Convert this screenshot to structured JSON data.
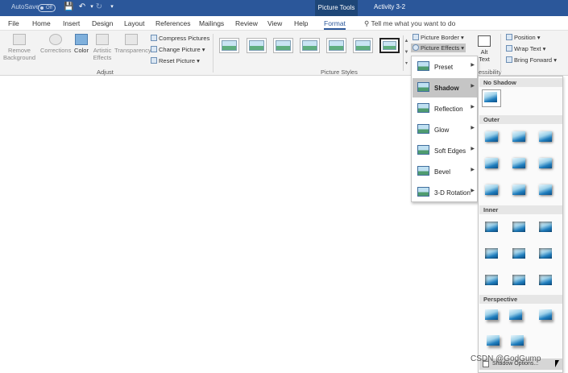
{
  "titlebar": {
    "autosave_label": "AutoSave",
    "autosave_state": "Off",
    "context_tab": "Picture Tools",
    "document_title": "Activity 3-2"
  },
  "tabs": [
    "File",
    "Home",
    "Insert",
    "Design",
    "Layout",
    "References",
    "Mailings",
    "Review",
    "View",
    "Help",
    "Format"
  ],
  "active_tab": "Format",
  "tell_me": "Tell me what you want to do",
  "ribbon": {
    "adjust": {
      "remove_background": "Remove Background",
      "corrections": "Corrections",
      "color": "Color",
      "artistic_effects": "Artistic Effects",
      "transparency": "Transparency",
      "compress_pictures": "Compress Pictures",
      "change_picture": "Change Picture",
      "reset_picture": "Reset Picture",
      "group_label": "Adjust"
    },
    "picture_styles": {
      "group_label": "Picture Styles",
      "picture_border": "Picture Border",
      "picture_effects": "Picture Effects"
    },
    "accessibility": {
      "alt_text": "Alt Text",
      "group_label_fragment": "essibility"
    },
    "arrange": {
      "position": "Position",
      "wrap_text": "Wrap Text",
      "bring_forward": "Bring Forward"
    }
  },
  "effects_menu": {
    "items": [
      "Preset",
      "Shadow",
      "Reflection",
      "Glow",
      "Soft Edges",
      "Bevel",
      "3-D Rotation"
    ],
    "selected": "Shadow"
  },
  "shadow_flyout": {
    "sections": [
      "No Shadow",
      "Outer",
      "Inner",
      "Perspective"
    ],
    "options_label": "Shadow Options..."
  },
  "watermark": "CSDN @GodGump",
  "colors": {
    "titlebar": "#2b579a",
    "context_tab": "#1e4677",
    "active_tab_text": "#2b579a",
    "menu_selected": "#c5c5c5"
  }
}
